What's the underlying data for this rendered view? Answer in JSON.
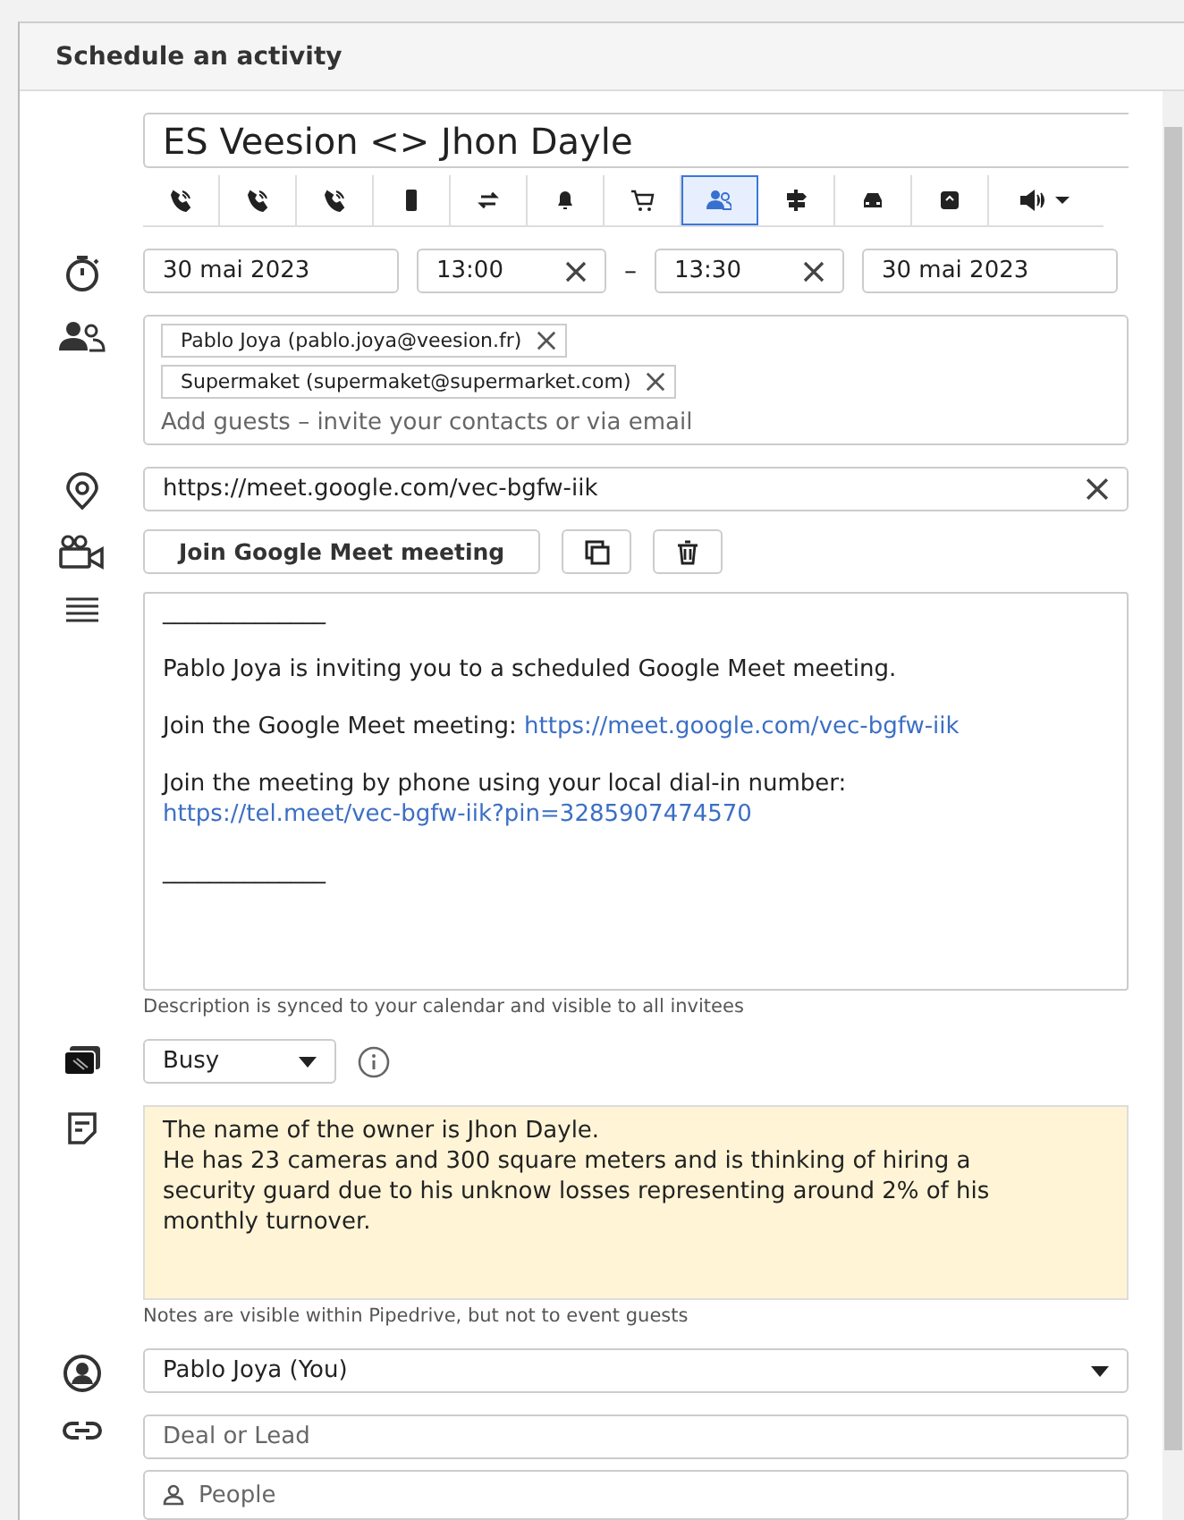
{
  "window": {
    "title": "Schedule an activity"
  },
  "subject": "ES Veesion <> Jhon Dayle",
  "activity_types": [
    {
      "selected": false
    },
    {
      "selected": false
    },
    {
      "selected": false
    },
    {
      "selected": false
    },
    {
      "selected": false
    },
    {
      "selected": false
    },
    {
      "selected": false
    },
    {
      "selected": true
    },
    {
      "selected": false
    },
    {
      "selected": false
    },
    {
      "selected": false
    },
    {
      "selected": false,
      "kind": "more"
    }
  ],
  "when": {
    "start_date": "30 mai 2023",
    "start_time": "13:00",
    "separator": "–",
    "end_time": "13:30",
    "end_date": "30 mai 2023"
  },
  "guests": {
    "chips": [
      "Pablo Joya (pablo.joya@veesion.fr)",
      "Supermaket (supermaket@supermarket.com)"
    ],
    "placeholder": "Add guests – invite your contacts or via email"
  },
  "location": "https://meet.google.com/vec-bgfw-iik",
  "meet": {
    "join_button": "Join Google Meet meeting"
  },
  "description": {
    "paragraphs": [
      {
        "text": "______________"
      },
      {
        "text": "Pablo Joya is inviting you to a scheduled Google Meet meeting."
      },
      {
        "text": "Join the Google Meet meeting: ",
        "link": "https://meet.google.com/vec-bgfw-iik"
      },
      {
        "text": "Join the meeting by phone using your local dial-in number: ",
        "link": "https://tel.meet/vec-bgfw-iik?pin=3285907474570"
      },
      {
        "text": "______________"
      }
    ],
    "hint": "Description is synced to your calendar and visible to all invitees"
  },
  "availability": "Busy",
  "notes": {
    "lines": [
      "The name of the owner is Jhon Dayle.",
      "He has 23 cameras and 300 square meters and is thinking of hiring a security guard due to his unknow losses representing around 2% of his monthly turnover."
    ],
    "hint": "Notes are visible within Pipedrive, but not to event guests"
  },
  "owner": "Pablo Joya (You)",
  "deal_placeholder": "Deal or Lead",
  "people_placeholder": "People"
}
